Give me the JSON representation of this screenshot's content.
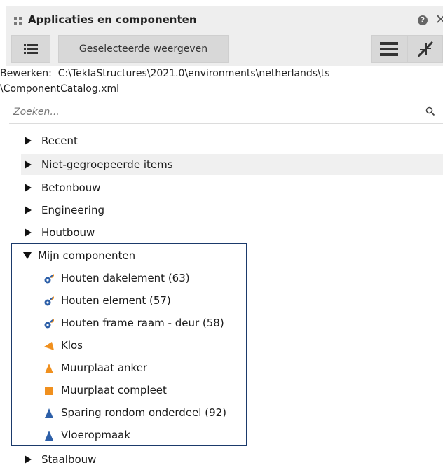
{
  "window": {
    "title": "Applicaties en componenten",
    "help_icon": "help-icon",
    "close_icon": "close-icon"
  },
  "toolbar": {
    "list_icon": "list-icon",
    "show_selected_label": "Geselecteerde weergeven",
    "menu_icon": "hamburger-menu-icon",
    "shrink_icon": "collapse-arrows-icon"
  },
  "path": {
    "prefix": "Bewerken:",
    "line1": "C:\\TeklaStructures\\2021.0\\environments\\netherlands\\ts",
    "line2": "\\ComponentCatalog.xml"
  },
  "search": {
    "placeholder": "Zoeken...",
    "icon": "search-icon"
  },
  "tree": {
    "groups": [
      {
        "label": "Recent",
        "expanded": false
      },
      {
        "label": "Niet-gegroepeerde items",
        "expanded": false
      },
      {
        "label": "Betonbouw",
        "expanded": false
      },
      {
        "label": "Engineering",
        "expanded": false
      },
      {
        "label": "Houtbouw",
        "expanded": false
      },
      {
        "label": "Mijn componenten",
        "expanded": true
      },
      {
        "label": "Staalbouw",
        "expanded": false
      }
    ],
    "my_components": [
      {
        "label": "Houten dakelement (63)",
        "icon": "gear-component-icon"
      },
      {
        "label": "Houten element (57)",
        "icon": "gear-component-icon"
      },
      {
        "label": "Houten frame raam - deur (58)",
        "icon": "gear-component-icon"
      },
      {
        "label": "Klos",
        "icon": "orange-wedge-icon"
      },
      {
        "label": "Muurplaat anker",
        "icon": "orange-triangle-icon"
      },
      {
        "label": "Muurplaat compleet",
        "icon": "orange-square-icon"
      },
      {
        "label": "Sparing rondom onderdeel (92)",
        "icon": "blue-triangle-icon"
      },
      {
        "label": "Vloeropmaak",
        "icon": "blue-triangle-icon"
      }
    ]
  },
  "colors": {
    "title_bg": "#eeeeee",
    "button_bg": "#d8d8d8",
    "highlight_box": "#1b3a6b",
    "component_blue": "#2d5fa8",
    "component_orange": "#f0901e"
  }
}
